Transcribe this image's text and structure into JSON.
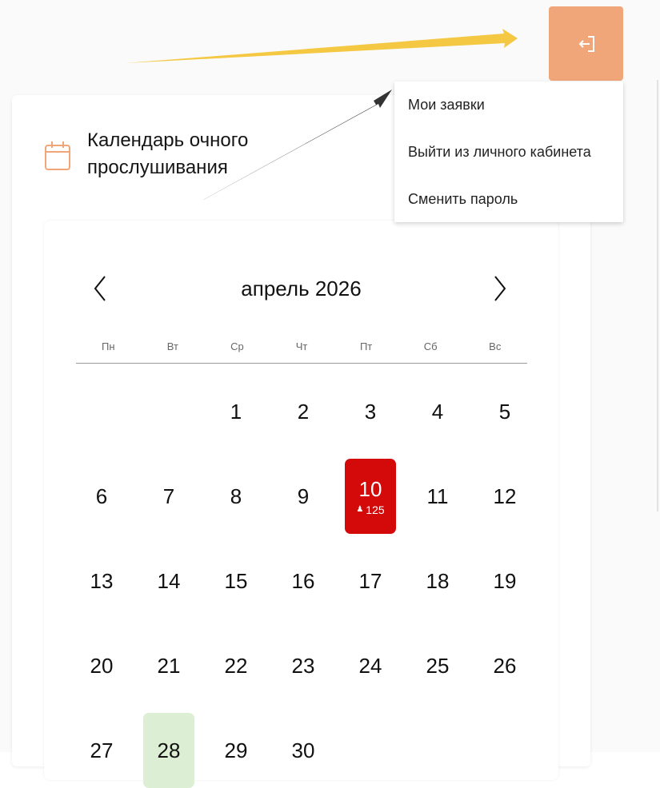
{
  "calendar": {
    "title": "Календарь очного прослушивания",
    "month": "апрель 2026",
    "weekdays": [
      "Пн",
      "Вт",
      "Ср",
      "Чт",
      "Пт",
      "Сб",
      "Вс"
    ],
    "days": [
      [
        "",
        "",
        "1",
        "2",
        "3",
        "4",
        "5"
      ],
      [
        "6",
        "7",
        "8",
        "9",
        "10",
        "11",
        "12"
      ],
      [
        "13",
        "14",
        "15",
        "16",
        "17",
        "18",
        "19"
      ],
      [
        "20",
        "21",
        "22",
        "23",
        "24",
        "25",
        "26"
      ],
      [
        "27",
        "28",
        "29",
        "30",
        "",
        "",
        ""
      ]
    ],
    "selected_day": "10",
    "selected_count": "125",
    "highlighted_day": "28"
  },
  "menu": {
    "items": [
      "Мои заявки",
      "Выйти из личного кабинета",
      "Сменить пароль"
    ]
  },
  "colors": {
    "accent": "#f0a679",
    "selected": "#d40a0a",
    "highlight": "#dcefd4",
    "yellow_arrow": "#f4c842",
    "dark_arrow": "#333333"
  },
  "icons": {
    "logout": "logout-icon",
    "calendar": "calendar-icon",
    "prev": "chevron-left-icon",
    "next": "chevron-right-icon",
    "person": "person-icon"
  }
}
